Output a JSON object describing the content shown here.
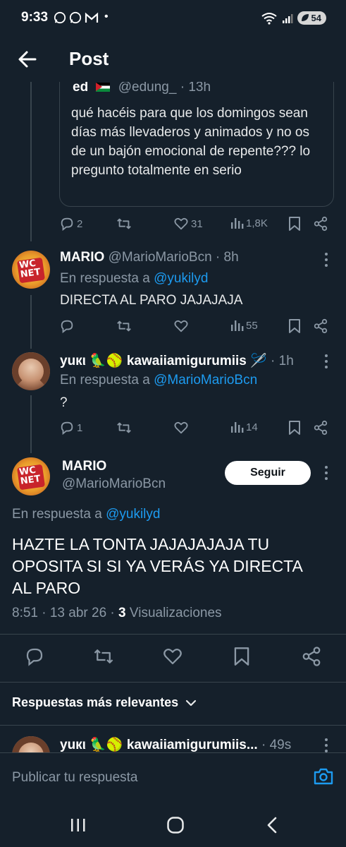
{
  "status_bar": {
    "time": "9:33",
    "battery": "54",
    "notification_icons": [
      "whatsapp-icon",
      "whatsapp-icon",
      "gmail-icon"
    ],
    "dot": "•"
  },
  "header": {
    "title": "Post"
  },
  "quoted_post": {
    "name": "ed",
    "handle": "@edung_",
    "time": "13h",
    "text": "qué hacéis para que los domingos sean días más llevaderos y animados y no os de un bajón emocional de repente??? lo pregunto totalmente en serio",
    "replies": "2",
    "likes": "31",
    "views": "1,8K"
  },
  "reply1": {
    "name": "MARIO",
    "handle": "@MarioMarioBcn",
    "time": "8h",
    "in_reply_prefix": "En respuesta a",
    "in_reply_to": "@yukilyd",
    "text": "DIRECTA AL PARO JAJAJAJA",
    "views": "55"
  },
  "reply2": {
    "name": "yuкι 🦜🥎 kawaiiamigurumiis 🪡",
    "time": "1h",
    "in_reply_prefix": "En respuesta a",
    "in_reply_to": "@MarioMarioBcn",
    "text": "?",
    "replies": "1",
    "views": "14"
  },
  "main_post": {
    "name": "MARIO",
    "handle": "@MarioMarioBcn",
    "follow_label": "Seguir",
    "in_reply_prefix": "En respuesta a",
    "in_reply_to": "@yukilyd",
    "text": "HAZTE LA TONTA JAJAJAJAJA TU OPOSITA SI SI YA VERÁS YA DIRECTA AL PARO",
    "datetime": "8:51 · 13 abr 26 · ",
    "views_count": "3",
    "views_label": "Visualizaciones"
  },
  "sort": {
    "label": "Respuestas más relevantes"
  },
  "next_reply": {
    "name": "yuкι 🦜🥎 kawaiiamigurumiis...",
    "time": "49s"
  },
  "composer": {
    "placeholder": "Publicar tu respuesta"
  },
  "colors": {
    "background": "#15202b",
    "accent": "#1d9bf0",
    "muted": "#8b98a5",
    "border": "#38444d"
  }
}
